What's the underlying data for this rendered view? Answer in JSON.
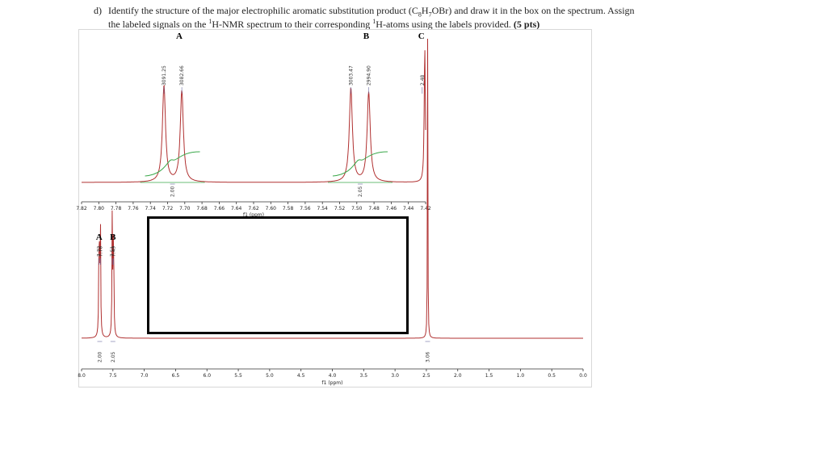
{
  "question": {
    "label": "d)",
    "line1_a": "Identify the structure of the major electrophilic aromatic substitution product (C",
    "line1_sub1": "8",
    "line1_b": "H",
    "line1_sub2": "7",
    "line1_c": "OBr) and draw it in the box on the spectrum.  Assign",
    "line2_a": "the labeled signals on the ",
    "line2_sup1": "1",
    "line2_b": "H-NMR spectrum to their corresponding ",
    "line2_sup2": "1",
    "line2_c": "H-atoms using the labels provided.  ",
    "points": "(5 pts)"
  },
  "colors": {
    "spectrum": "#b03030",
    "integral": "#3aa84a",
    "axis": "#333333",
    "peak_label_line": "#6a6aa0",
    "box": "#000000"
  },
  "chart_data": [
    {
      "type": "line",
      "title": "",
      "xlabel": "f1 (ppm)",
      "xlim": [
        7.42,
        7.825
      ],
      "x_reversed": true,
      "x_ticks": [
        "7.82",
        "7.80",
        "7.78",
        "7.76",
        "7.74",
        "7.72",
        "7.70",
        "7.68",
        "7.66",
        "7.64",
        "7.62",
        "7.60",
        "7.58",
        "7.56",
        "7.54",
        "7.52",
        "7.50",
        "7.48",
        "7.46",
        "7.44",
        "7.42"
      ],
      "signal_labels": [
        {
          "label": "A",
          "ppm": 7.71
        },
        {
          "label": "B",
          "ppm": 7.49
        },
        {
          "label": "C",
          "ppm": 7.425
        }
      ],
      "peak_picks": [
        {
          "text": "3091.25",
          "ppm": 7.728
        },
        {
          "text": "3082.66",
          "ppm": 7.707
        },
        {
          "text": "3003.47",
          "ppm": 7.508
        },
        {
          "text": "2994.90",
          "ppm": 7.487
        },
        {
          "text": "2.48",
          "ppm": 7.424
        }
      ],
      "integrals": [
        {
          "ppm": 7.718,
          "value": "2.00"
        },
        {
          "ppm": 7.497,
          "value": "2.05"
        }
      ],
      "peaks": [
        {
          "ppm": 7.728,
          "height": 0.72,
          "width": 0.0022
        },
        {
          "ppm": 7.707,
          "height": 0.68,
          "width": 0.0022
        },
        {
          "ppm": 7.508,
          "height": 0.7,
          "width": 0.0022
        },
        {
          "ppm": 7.487,
          "height": 0.67,
          "width": 0.0022
        },
        {
          "ppm": 7.421,
          "height": 1.0,
          "width": 0.0008
        }
      ]
    },
    {
      "type": "line",
      "title": "",
      "xlabel": "f1 (ppm)",
      "xlim": [
        0.0,
        8.0
      ],
      "x_reversed": true,
      "x_ticks": [
        "8.0",
        "7.5",
        "7.0",
        "6.5",
        "6.0",
        "5.5",
        "5.0",
        "4.5",
        "4.0",
        "3.5",
        "3.0",
        "2.5",
        "2.0",
        "1.5",
        "1.0",
        "0.5",
        "0.0"
      ],
      "signal_labels": [
        {
          "label": "A",
          "ppm": 7.72
        },
        {
          "label": "B",
          "ppm": 7.5
        }
      ],
      "peak_picks": [
        {
          "text": "7.72",
          "ppm": 7.72
        },
        {
          "text": "7.70",
          "ppm": 7.7
        },
        {
          "text": "7.51",
          "ppm": 7.51
        },
        {
          "text": "7.49",
          "ppm": 7.49
        }
      ],
      "integrals": [
        {
          "ppm": 7.71,
          "value": "2.00"
        },
        {
          "ppm": 7.5,
          "value": "2.05"
        },
        {
          "ppm": 2.48,
          "value": "3.06"
        }
      ],
      "peaks": [
        {
          "ppm": 7.72,
          "height": 0.42,
          "width": 0.006
        },
        {
          "ppm": 7.7,
          "height": 0.4,
          "width": 0.006
        },
        {
          "ppm": 7.51,
          "height": 0.41,
          "width": 0.006
        },
        {
          "ppm": 7.49,
          "height": 0.39,
          "width": 0.006
        },
        {
          "ppm": 2.48,
          "height": 1.0,
          "width": 0.004
        }
      ]
    }
  ]
}
